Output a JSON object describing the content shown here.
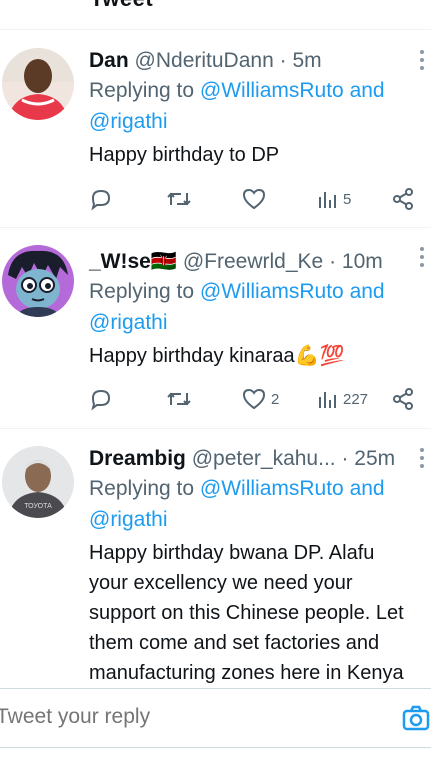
{
  "top": {
    "partial_text": "Tweet"
  },
  "tweets": [
    {
      "name": "Dan",
      "handle": "@NderituDann",
      "sep": "·",
      "time": "5m",
      "replying_prefix": "Replying to",
      "replying_link": "@WilliamsRuto and",
      "replying_link2": "@rigathi",
      "text": "Happy birthday to DP",
      "likes": "",
      "views": "5"
    },
    {
      "name": "_W!se🇰🇪",
      "handle": "@Freewrld_Ke",
      "sep": "·",
      "time": "10m",
      "replying_prefix": "Replying to",
      "replying_link": "@WilliamsRuto and",
      "replying_link2": "@rigathi",
      "text": "Happy birthday kinaraa💪💯",
      "likes": "2",
      "views": "227"
    },
    {
      "name": "Dreambig",
      "handle": "@peter_kahu...",
      "sep": "·",
      "time": "25m",
      "replying_prefix": "Replying to",
      "replying_link": "@WilliamsRuto and",
      "replying_link2": "@rigathi",
      "text_lines": [
        "Happy birthday bwana DP. Alafu",
        "your excellency we need your",
        "support on this Chinese people. Let",
        "them come and set factories and",
        "manufacturing zones here in Kenya"
      ],
      "avatar_text": "ТОУОТА"
    }
  ],
  "composer": {
    "placeholder": "Tweet your reply"
  },
  "colors": {
    "link": "#1d9bf0",
    "muted": "#536471",
    "text": "#0f1419",
    "divider": "#eff3f4"
  },
  "icons": [
    "reply-icon",
    "retweet-icon",
    "like-icon",
    "views-icon",
    "share-icon",
    "more-icon",
    "camera-icon"
  ]
}
